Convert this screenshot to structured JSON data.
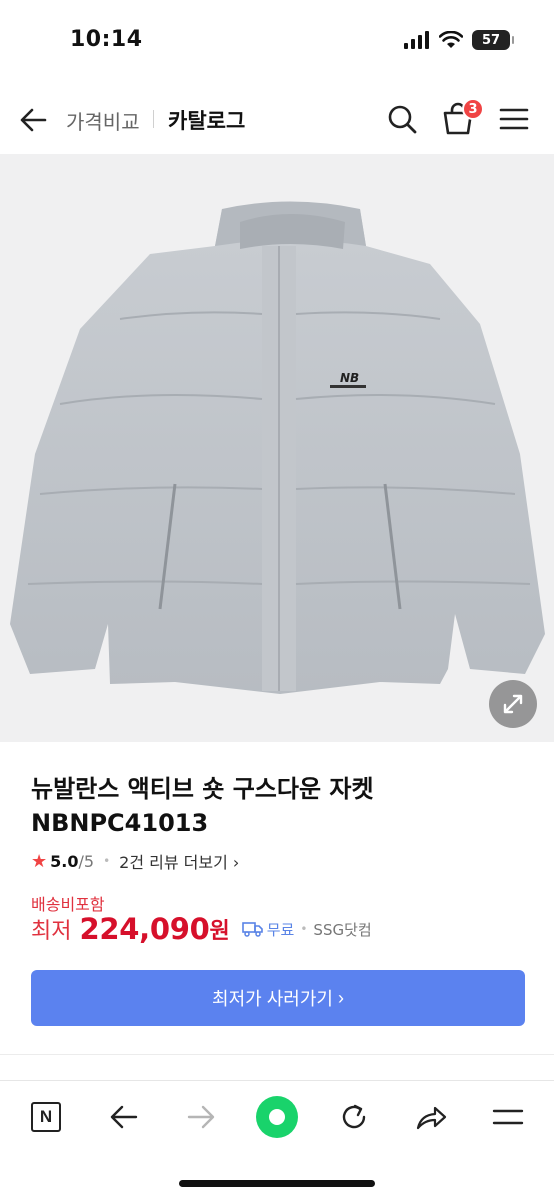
{
  "status_bar": {
    "time": "10:14",
    "battery": "57",
    "icons": [
      "signal-icon",
      "wifi-icon",
      "battery-icon"
    ]
  },
  "header": {
    "breadcrumb_prev": "가격비교",
    "breadcrumb_current": "카탈로그",
    "cart_count": "3",
    "icons": [
      "back-arrow-icon",
      "search-icon",
      "cart-icon",
      "menu-icon"
    ]
  },
  "product": {
    "image_alt_icon": "jacket-image",
    "title": "뉴발란스 액티브 숏 구스다운 자켓 NBNPC41013",
    "rating": "5.0",
    "rating_max": "/5",
    "review_link": "2건 리뷰 더보기",
    "shipping_note": "배송비포함",
    "price_label": "최저",
    "price_value": "224,090",
    "price_unit": "원",
    "shipping_fee": "무료",
    "mall_name": "SSG닷컴",
    "buy_button": "최저가 사러가기",
    "accent_color": "#d6102b",
    "button_color": "#5b82ef"
  },
  "toolbar": {
    "items": [
      "n-home-icon",
      "back-icon",
      "forward-icon",
      "green-assistant-icon",
      "reload-icon",
      "share-icon",
      "menu-icon"
    ],
    "n_label": "N"
  }
}
